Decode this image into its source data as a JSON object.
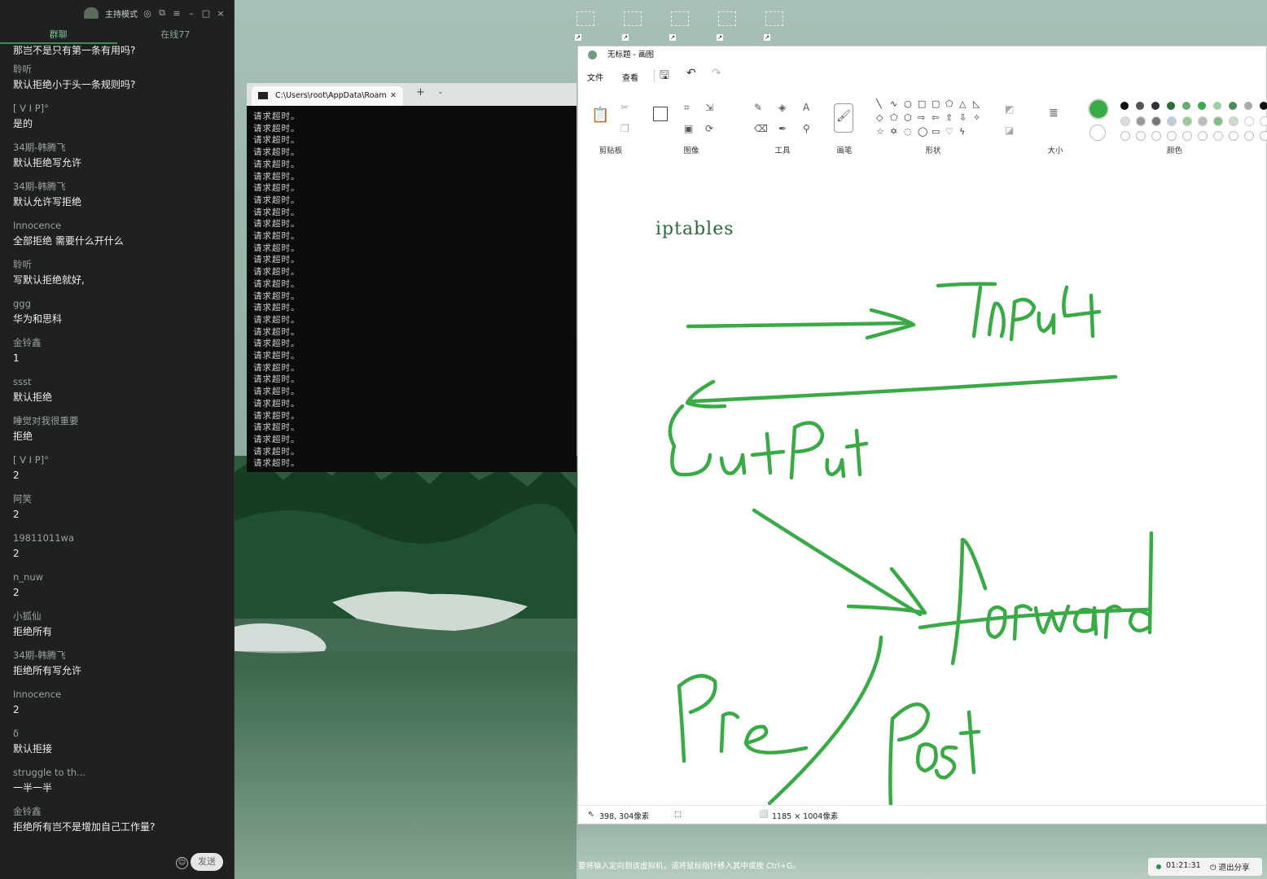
{
  "chat": {
    "header": {
      "mode": "主持模式"
    },
    "tabs": [
      "群聊",
      "在线77"
    ],
    "first_message": "那岂不是只有第一条有用吗?",
    "messages": [
      {
        "user": "聆听",
        "text": "默认拒绝小于头一条规则吗?"
      },
      {
        "user": "[ V I P]°",
        "text": "是的"
      },
      {
        "user": "34期-韩腾飞",
        "text": "默认拒绝写允许"
      },
      {
        "user": "34期-韩腾飞",
        "text": "默认允许写拒绝"
      },
      {
        "user": "Innocence",
        "text": "全部拒绝 需要什么开什么"
      },
      {
        "user": "聆听",
        "text": "写默认拒绝就好,"
      },
      {
        "user": "ggg",
        "text": "华为和思科"
      },
      {
        "user": "金铃鑫",
        "text": "1"
      },
      {
        "user": "ssst",
        "text": "默认拒绝"
      },
      {
        "user": "睡觉对我很重要",
        "text": "拒绝"
      },
      {
        "user": "[ V I P]°",
        "text": "2"
      },
      {
        "user": "阿笑",
        "text": "2"
      },
      {
        "user": "19811011wa",
        "text": "2"
      },
      {
        "user": "n_nuw",
        "text": "2"
      },
      {
        "user": "小狐仙",
        "text": "拒绝所有"
      },
      {
        "user": "34期-韩腾飞",
        "text": "拒绝所有写允许"
      },
      {
        "user": "Innocence",
        "text": "2"
      },
      {
        "user": "δ",
        "text": "默认拒接"
      },
      {
        "user": "struggle to th...",
        "text": "一半一半"
      },
      {
        "user": "金铃鑫",
        "text": "拒绝所有岂不是增加自己工作量?"
      }
    ],
    "send_label": "发送",
    "emoji_icon": "emoji-icon"
  },
  "terminal": {
    "tab_title": "C:\\Users\\root\\AppData\\Roam",
    "line_text": "请求超时。",
    "line_count": 30
  },
  "paint": {
    "title": "无标题 - 画图",
    "menu": {
      "file": "文件",
      "view": "查看"
    },
    "groups": {
      "clipboard": "剪贴板",
      "image": "图像",
      "tools": "工具",
      "brushes": "画笔",
      "shapes": "形状",
      "size": "大小",
      "colors": "颜色"
    },
    "canvas_text": "iptables",
    "handwritten": [
      "Input",
      "OutPut",
      "forward",
      "Pre",
      "Post"
    ],
    "status": {
      "cursor": "398, 304像素",
      "canvas_size": "1185 × 1004像素"
    },
    "stroke_color": "#3aaa47",
    "primary_color": "#3aaa47"
  },
  "system": {
    "hint": "要将输入定向到该虚拟机，请将鼠标指针移入其中或按 Ctrl+G。",
    "clock": "01:21:31",
    "exit_share": "退出分享"
  }
}
